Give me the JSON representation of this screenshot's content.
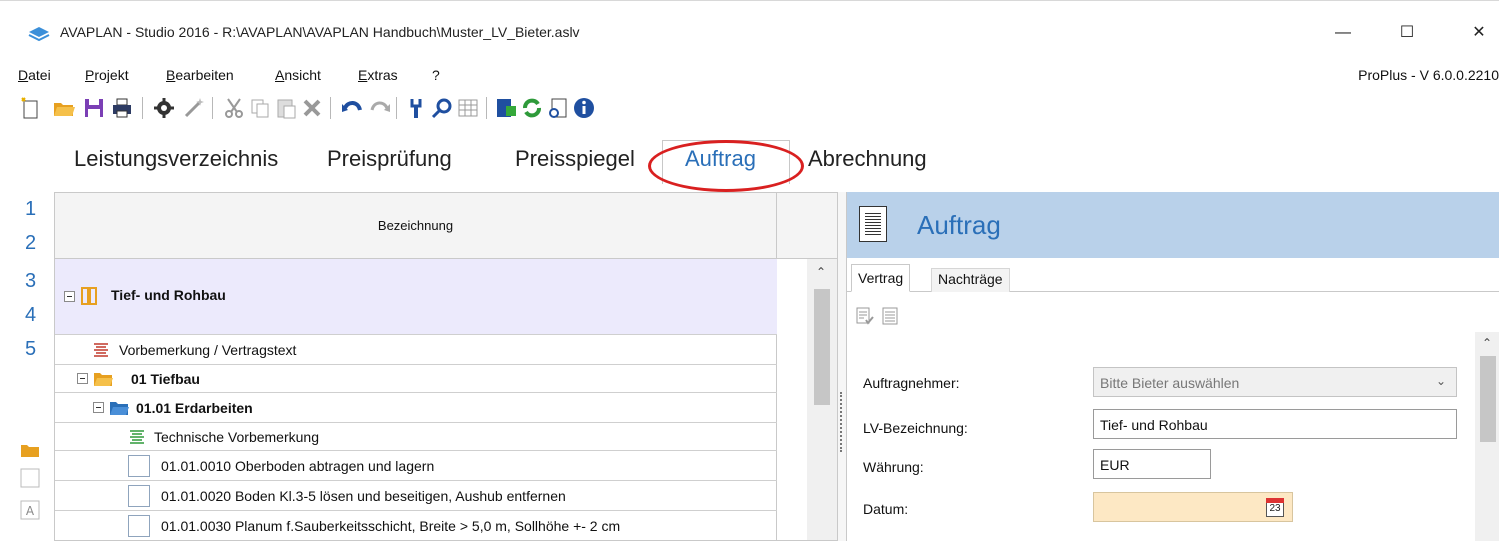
{
  "window": {
    "title": "AVAPLAN - Studio 2016 - R:\\AVAPLAN\\AVAPLAN Handbuch\\Muster_LV_Bieter.aslv",
    "minimize_glyph": "—",
    "maximize_glyph": "☐",
    "close_glyph": "✕"
  },
  "menu": {
    "items": [
      {
        "first": "D",
        "rest": "atei"
      },
      {
        "first": "P",
        "rest": "rojekt"
      },
      {
        "first": "B",
        "rest": "earbeiten"
      },
      {
        "first": "A",
        "rest": "nsicht"
      },
      {
        "first": "E",
        "rest": "xtras"
      },
      {
        "first": "",
        "rest": "?"
      }
    ],
    "version": "ProPlus - V 6.0.0.2210"
  },
  "toolbar": {
    "icons": [
      "new-icon",
      "open-folder-icon",
      "save-icon",
      "print-icon",
      "settings-gear-icon",
      "wand-icon",
      "cut-icon",
      "copy-icon",
      "paste-icon",
      "delete-icon",
      "undo-icon",
      "redo-icon",
      "tools-icon",
      "search-icon",
      "table-icon",
      "export-icon",
      "refresh-icon",
      "document-view-icon",
      "info-icon"
    ]
  },
  "modules": {
    "tabs": [
      "Leistungsverzeichnis",
      "Preisprüfung",
      "Preisspiegel",
      "Auftrag",
      "Abrechnung"
    ],
    "active": "Auftrag"
  },
  "sidebar": {
    "levels": [
      "1",
      "2",
      "3",
      "4",
      "5"
    ]
  },
  "grid": {
    "header": "Bezeichnung",
    "rows": [
      {
        "text": "Tief- und Rohbau"
      },
      {
        "text": "Vorbemerkung / Vertragstext"
      },
      {
        "text": "01  Tiefbau"
      },
      {
        "text": "01.01  Erdarbeiten"
      },
      {
        "text": "Technische Vorbemerkung"
      },
      {
        "text": "01.01.0010  Oberboden abtragen und lagern"
      },
      {
        "text": "01.01.0020  Boden Kl.3-5 lösen und beseitigen, Aushub entfernen"
      },
      {
        "text": "01.01.0030  Planum f.Sauberkeitsschicht, Breite > 5,0 m, Sollhöhe +- 2 cm"
      }
    ]
  },
  "panel": {
    "title": "Auftrag",
    "subtabs": [
      "Vertrag",
      "Nachträge"
    ],
    "fields": {
      "auftragnehmer_label": "Auftragnehmer:",
      "auftragnehmer_value": "Bitte Bieter auswählen",
      "lv_label": "LV-Bezeichnung:",
      "lv_value": "Tief- und Rohbau",
      "waehrung_label": "Währung:",
      "waehrung_value": "EUR",
      "datum_label": "Datum:",
      "datum_value": "",
      "calendar_day": "23"
    }
  },
  "colors": {
    "accent_blue": "#2a6fb8",
    "panel_header": "#b9d1ea",
    "highlight_ring": "#d92020",
    "root_row": "#eceafc",
    "date_field": "#fde8c4"
  }
}
